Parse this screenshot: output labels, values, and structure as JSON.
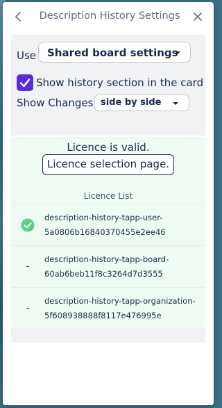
{
  "header": {
    "title": "Description History Settings",
    "back_icon": "chevron-left-icon",
    "close_icon": "close-icon"
  },
  "settings": {
    "use_label": "Use",
    "use_value": "Shared board settings",
    "show_history_label": "Show history section in the card",
    "show_history_checked": true,
    "show_changes_label": "Show Changes:",
    "show_changes_value": "side by side"
  },
  "licence": {
    "status": "Licence is valid.",
    "selection_button": "Licence selection page.",
    "list_heading": "Licence List",
    "items": [
      {
        "marker": "check",
        "line1": "description-history-tapp-user-",
        "line2": "5a0806b16840370455e2ee46"
      },
      {
        "marker": "-",
        "line1": "description-history-tapp-board-",
        "line2": "60ab6beb11f8c3264d7d3555"
      },
      {
        "marker": "-",
        "line1": "description-history-tapp-organization-",
        "line2": "5f608938888f8117e476995e"
      }
    ]
  },
  "colors": {
    "accent": "#5b2bd8",
    "valid_bg": "#effbf2",
    "check_green": "#5ccf86",
    "text": "#172b4d"
  }
}
